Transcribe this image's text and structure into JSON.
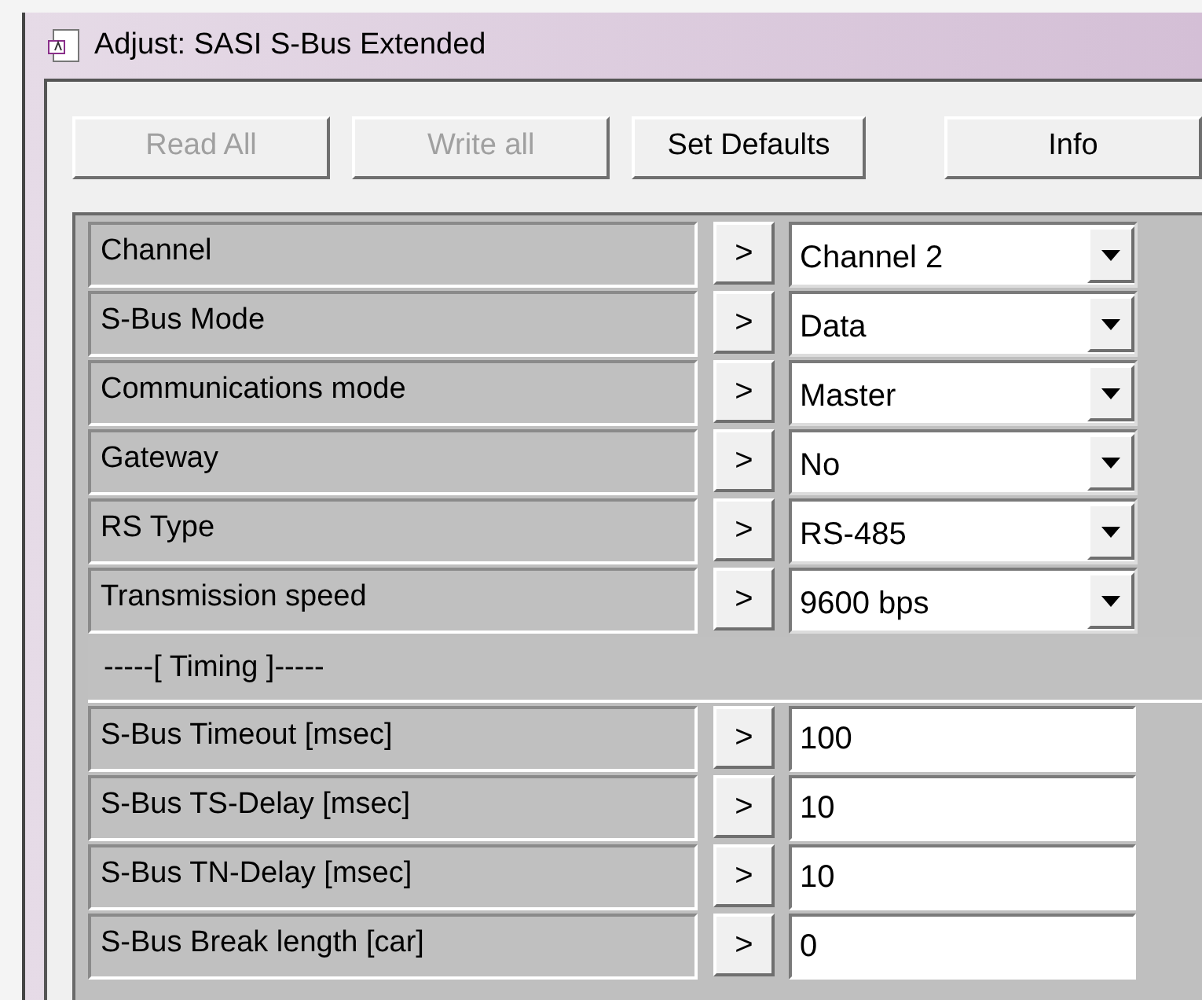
{
  "window": {
    "title": "Adjust: SASI S-Bus Extended"
  },
  "toolbar": [
    {
      "label": "Read All",
      "disabled": true
    },
    {
      "label": "Write all",
      "disabled": true
    },
    {
      "label": "Set Defaults",
      "disabled": false
    },
    {
      "label": "Info",
      "disabled": false
    }
  ],
  "rows": [
    {
      "kind": "select",
      "label": "Channel",
      "button": ">",
      "value": "Channel 2"
    },
    {
      "kind": "select",
      "label": "S-Bus Mode",
      "button": ">",
      "value": "Data"
    },
    {
      "kind": "select",
      "label": "Communications mode",
      "button": ">",
      "value": "Master"
    },
    {
      "kind": "select",
      "label": "Gateway",
      "button": ">",
      "value": "No"
    },
    {
      "kind": "select",
      "label": "RS Type",
      "button": ">",
      "value": "RS-485"
    },
    {
      "kind": "select",
      "label": "Transmission speed",
      "button": ">",
      "value": "9600 bps"
    },
    {
      "kind": "section",
      "label": "-----[ Timing ]-----"
    },
    {
      "kind": "text",
      "label": "S-Bus Timeout [msec]",
      "button": ">",
      "value": "100"
    },
    {
      "kind": "text",
      "label": "S-Bus TS-Delay [msec]",
      "button": ">",
      "value": "10"
    },
    {
      "kind": "text",
      "label": "S-Bus TN-Delay [msec]",
      "button": ">",
      "value": "10"
    },
    {
      "kind": "text",
      "label": "S-Bus Break length [car]",
      "button": ">",
      "value": "0"
    }
  ]
}
